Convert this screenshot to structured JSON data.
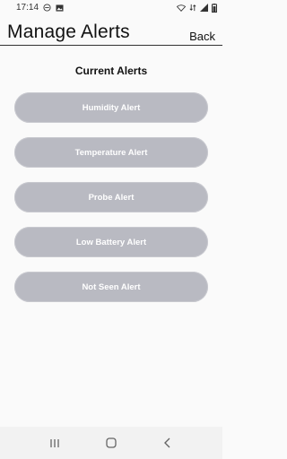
{
  "status_bar": {
    "time": "17:14",
    "icons_left": [
      "do-not-disturb-icon",
      "image-icon"
    ],
    "icons_right": [
      "wifi-icon",
      "data-sync-icon",
      "signal-icon",
      "battery-icon"
    ]
  },
  "header": {
    "title": "Manage Alerts",
    "back_label": "Back"
  },
  "main": {
    "section_title": "Current Alerts",
    "alerts": [
      {
        "label": "Humidity Alert"
      },
      {
        "label": "Temperature Alert"
      },
      {
        "label": "Probe Alert"
      },
      {
        "label": "Low Battery Alert"
      },
      {
        "label": "Not Seen Alert"
      }
    ]
  },
  "nav_bar": {
    "buttons": [
      "recent-apps-icon",
      "home-icon",
      "back-icon"
    ]
  },
  "colors": {
    "background": "#fafafa",
    "alert_button": "#b9bac2",
    "alert_text": "#ffffff",
    "title_text": "#111111"
  }
}
